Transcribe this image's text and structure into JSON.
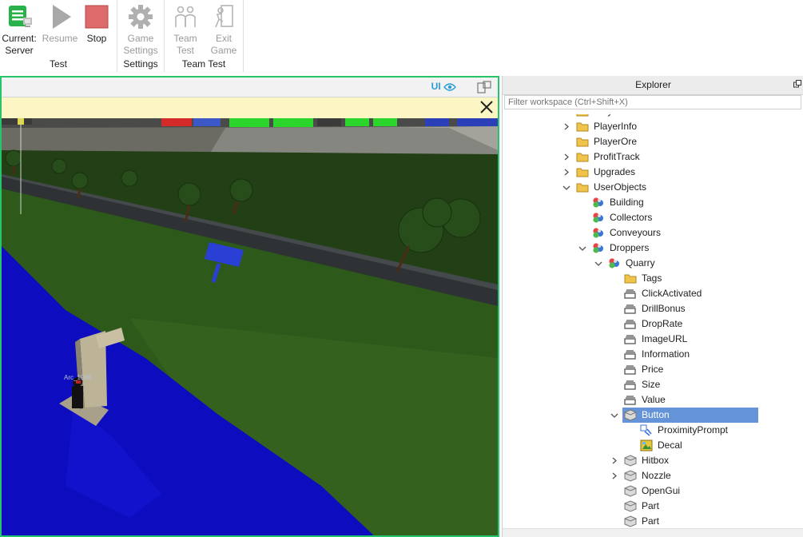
{
  "ribbon": {
    "groups": [
      {
        "label": "Test",
        "buttons": [
          {
            "label": "Current:\nServer",
            "icon": "server-icon",
            "enabled": true
          },
          {
            "label": "Resume",
            "icon": "play-icon",
            "enabled": false
          },
          {
            "label": "Stop",
            "icon": "stop-icon",
            "enabled": true
          }
        ]
      },
      {
        "label": "Settings",
        "buttons": [
          {
            "label": "Game\nSettings",
            "icon": "gear-icon",
            "enabled": false
          }
        ]
      },
      {
        "label": "Team Test",
        "buttons": [
          {
            "label": "Team\nTest",
            "icon": "team-icon",
            "enabled": false
          },
          {
            "label": "Exit\nGame",
            "icon": "exit-icon",
            "enabled": false
          }
        ]
      }
    ]
  },
  "viewport": {
    "ui_toggle_label": "UI",
    "player_name": "Arc_1996"
  },
  "explorer": {
    "title": "Explorer",
    "filter_placeholder": "Filter workspace (Ctrl+Shift+X)",
    "items": [
      {
        "label": "PlayerBoosts",
        "icon": "folder-icon",
        "depth": 0,
        "arrow": "none"
      },
      {
        "label": "PlayerInfo",
        "icon": "folder-icon",
        "depth": 0,
        "arrow": "collapsed"
      },
      {
        "label": "PlayerOre",
        "icon": "folder-icon",
        "depth": 0,
        "arrow": "none"
      },
      {
        "label": "ProfitTrack",
        "icon": "folder-icon",
        "depth": 0,
        "arrow": "collapsed"
      },
      {
        "label": "Upgrades",
        "icon": "folder-icon",
        "depth": 0,
        "arrow": "collapsed"
      },
      {
        "label": "UserObjects",
        "icon": "folder-icon",
        "depth": 0,
        "arrow": "expanded"
      },
      {
        "label": "Building",
        "icon": "model-icon",
        "depth": 1,
        "arrow": "none"
      },
      {
        "label": "Collectors",
        "icon": "model-icon",
        "depth": 1,
        "arrow": "none"
      },
      {
        "label": "Conveyours",
        "icon": "model-icon",
        "depth": 1,
        "arrow": "none"
      },
      {
        "label": "Droppers",
        "icon": "model-icon",
        "depth": 1,
        "arrow": "expanded"
      },
      {
        "label": "Quarry",
        "icon": "model-icon",
        "depth": 2,
        "arrow": "expanded"
      },
      {
        "label": "Tags",
        "icon": "folder-icon",
        "depth": 3,
        "arrow": "none"
      },
      {
        "label": "ClickActivated",
        "icon": "value-icon",
        "depth": 3,
        "arrow": "none"
      },
      {
        "label": "DrillBonus",
        "icon": "value-icon",
        "depth": 3,
        "arrow": "none"
      },
      {
        "label": "DropRate",
        "icon": "value-icon",
        "depth": 3,
        "arrow": "none"
      },
      {
        "label": "ImageURL",
        "icon": "value-icon",
        "depth": 3,
        "arrow": "none"
      },
      {
        "label": "Information",
        "icon": "value-icon",
        "depth": 3,
        "arrow": "none"
      },
      {
        "label": "Price",
        "icon": "value-icon",
        "depth": 3,
        "arrow": "none"
      },
      {
        "label": "Size",
        "icon": "value-icon",
        "depth": 3,
        "arrow": "none"
      },
      {
        "label": "Value",
        "icon": "value-icon",
        "depth": 3,
        "arrow": "none"
      },
      {
        "label": "Button",
        "icon": "part-icon",
        "depth": 3,
        "arrow": "expanded",
        "selected": true
      },
      {
        "label": "ProximityPrompt",
        "icon": "proximity-prompt-icon",
        "depth": 4,
        "arrow": "none"
      },
      {
        "label": "Decal",
        "icon": "decal-icon",
        "depth": 4,
        "arrow": "none"
      },
      {
        "label": "Hitbox",
        "icon": "part-icon",
        "depth": 3,
        "arrow": "collapsed"
      },
      {
        "label": "Nozzle",
        "icon": "part-icon",
        "depth": 3,
        "arrow": "collapsed"
      },
      {
        "label": "OpenGui",
        "icon": "part-icon",
        "depth": 3,
        "arrow": "none"
      },
      {
        "label": "Part",
        "icon": "part-icon",
        "depth": 3,
        "arrow": "none"
      },
      {
        "label": "Part",
        "icon": "part-icon",
        "depth": 3,
        "arrow": "none"
      }
    ]
  },
  "colors": {
    "viewport_border": "#26c46b",
    "selection": "#6493d8",
    "folder": "#f0c44c",
    "notice_bar": "#fbf6c3"
  }
}
